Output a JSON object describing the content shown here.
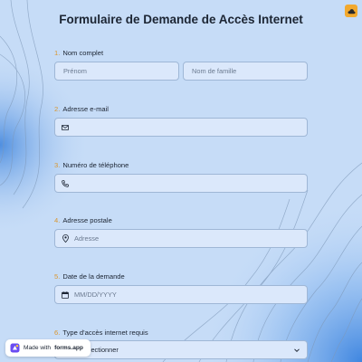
{
  "form": {
    "title": "Formulaire de Demande de Accès Internet"
  },
  "questions": [
    {
      "number": "1.",
      "label": "Nom complet",
      "placeholders": [
        "Prénom",
        "Nom de famille"
      ]
    },
    {
      "number": "2.",
      "label": "Adresse e-mail",
      "icon": "mail-icon",
      "placeholder": ""
    },
    {
      "number": "3.",
      "label": "Numéro de téléphone",
      "icon": "phone-icon",
      "placeholder": ""
    },
    {
      "number": "4.",
      "label": "Adresse postale",
      "icon": "location-pin-icon",
      "placeholder": "Adresse"
    },
    {
      "number": "5.",
      "label": "Date de la demande",
      "icon": "calendar-icon",
      "placeholder": "MM/DD/YYYY"
    },
    {
      "number": "6.",
      "label": "Type d'accès internet requis",
      "select_value": "sélectionner",
      "icon": "chevron-down-icon"
    }
  ],
  "badge": {
    "prefix": "Made with",
    "brand": "forms.app"
  },
  "colors": {
    "accent_number": "#d9962f",
    "background": "#c6dcf7",
    "field_bg": "#dbe8fb",
    "theme_button": "#f2a92e"
  }
}
